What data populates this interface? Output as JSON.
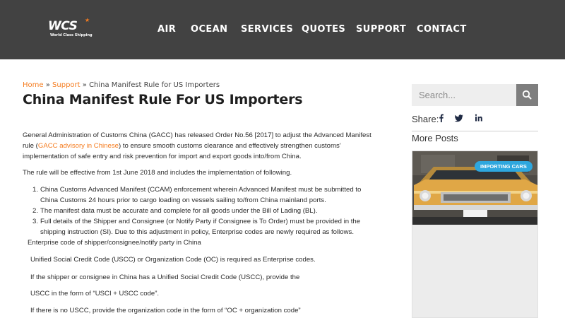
{
  "header": {
    "logo": {
      "text": "WCS",
      "tagline": "World Class Shipping"
    },
    "nav": [
      "AIR",
      "OCEAN",
      "SERVICES",
      "QUOTES",
      "SUPPORT",
      "CONTACT"
    ]
  },
  "breadcrumb": {
    "home": "Home",
    "sep": "»",
    "support": "Support",
    "current": "China Manifest Rule for US Importers"
  },
  "page": {
    "title": "China Manifest Rule For US Importers"
  },
  "article": {
    "intro": {
      "before": "General Administration of Customs China (GACC) has released Order No.56 [2017] to adjust the Advanced Manifest rule (",
      "link": "GACC advisory in Chinese",
      "after": ") to ensure smooth customs clearance and effectively strengthen customs' implementation of safe entry and risk prevention for import and export goods into/from China."
    },
    "effective": "The rule will be effective from 1st June 2018 and includes the implementation of following.",
    "list": [
      {
        "num": "1.",
        "text": "China Customs Advanced Manifest (CCAM) enforcement wherein Advanced Manifest must be submitted to China Customs 24 hours prior to cargo loading on vessels sailing to/from China mainland ports."
      },
      {
        "num": "2.",
        "text": "The manifest data must be accurate and complete for all goods under the Bill of Lading (BL)."
      },
      {
        "num": "3.",
        "text": "Full details of the Shipper and Consignee (or Notify Party if Consignee is To Order) must be provided in the shipping instruction (SI). Due to this adjustment in policy, Enterprise codes are newly required as follows."
      }
    ],
    "lines": [
      "Enterprise code of shipper/consignee/notify party in China",
      "Unified Social Credit Code (USCC) or Organization Code (OC) is required as Enterprise codes.",
      "If the shipper or consignee in China has a Unified Social Credit Code (USCC), provide the",
      "USCC in the form of “USCI + USCC code”.",
      "If there is no USCC, provide the organization code in the form of “OC + organization code”"
    ]
  },
  "sidebar": {
    "search": {
      "placeholder": "Search..."
    },
    "share_label": "Share:",
    "more_posts": "More Posts",
    "post": {
      "badge": "IMPORTING CARS"
    }
  },
  "colors": {
    "header_bg": "#424242",
    "accent": "#f57c1f",
    "badge": "#2ea7de"
  },
  "icons": [
    "search-icon",
    "facebook-icon",
    "twitter-icon",
    "linkedin-icon"
  ]
}
